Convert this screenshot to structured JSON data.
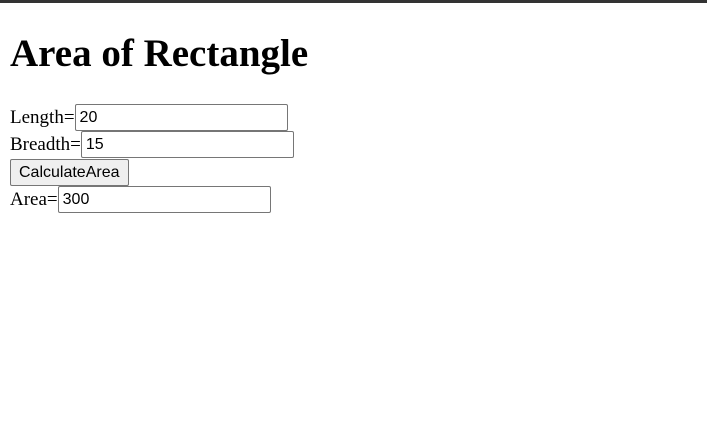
{
  "page": {
    "title": "Area of Rectangle"
  },
  "form": {
    "length_label": "Length=",
    "length_value": "20",
    "breadth_label": "Breadth=",
    "breadth_value": "15",
    "calculate_button_label": "CalculateArea",
    "area_label": "Area=",
    "area_value": "300"
  }
}
